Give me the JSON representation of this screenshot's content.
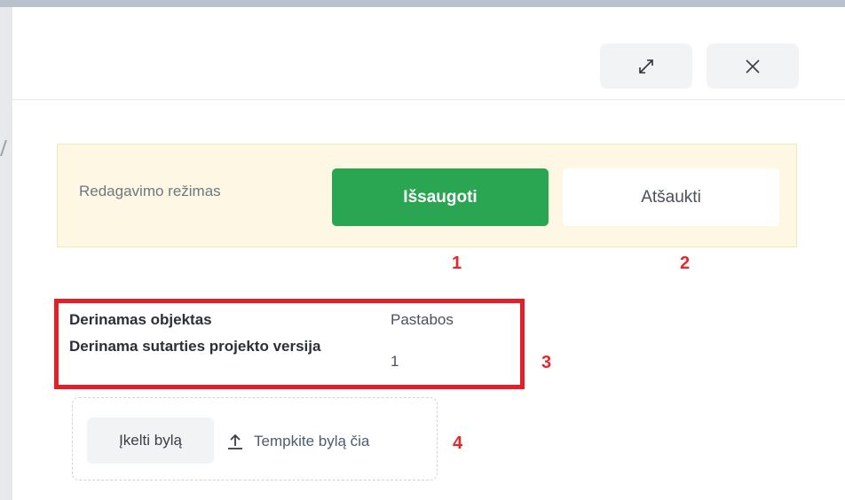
{
  "header": {
    "expand_icon": "expand-arrows-icon",
    "close_icon": "close-x-icon"
  },
  "edit_bar": {
    "mode_label": "Redagavimo režimas",
    "save_label": "Išsaugoti",
    "cancel_label": "Atšaukti"
  },
  "markers": [
    "1",
    "2",
    "3",
    "4"
  ],
  "info": {
    "rows": [
      {
        "label": "Derinamas objektas",
        "value": "Pastabos"
      },
      {
        "label": "Derinama sutarties projekto versija",
        "value": "1"
      }
    ]
  },
  "upload": {
    "button_label": "Įkelti bylą",
    "drag_label": "Tempkite bylą čia",
    "icon": "upload-arrow-icon"
  },
  "colors": {
    "save_button": "#2aa552",
    "edit_bar_bg": "#fdf7e4",
    "annotation_red": "#e61e27"
  }
}
